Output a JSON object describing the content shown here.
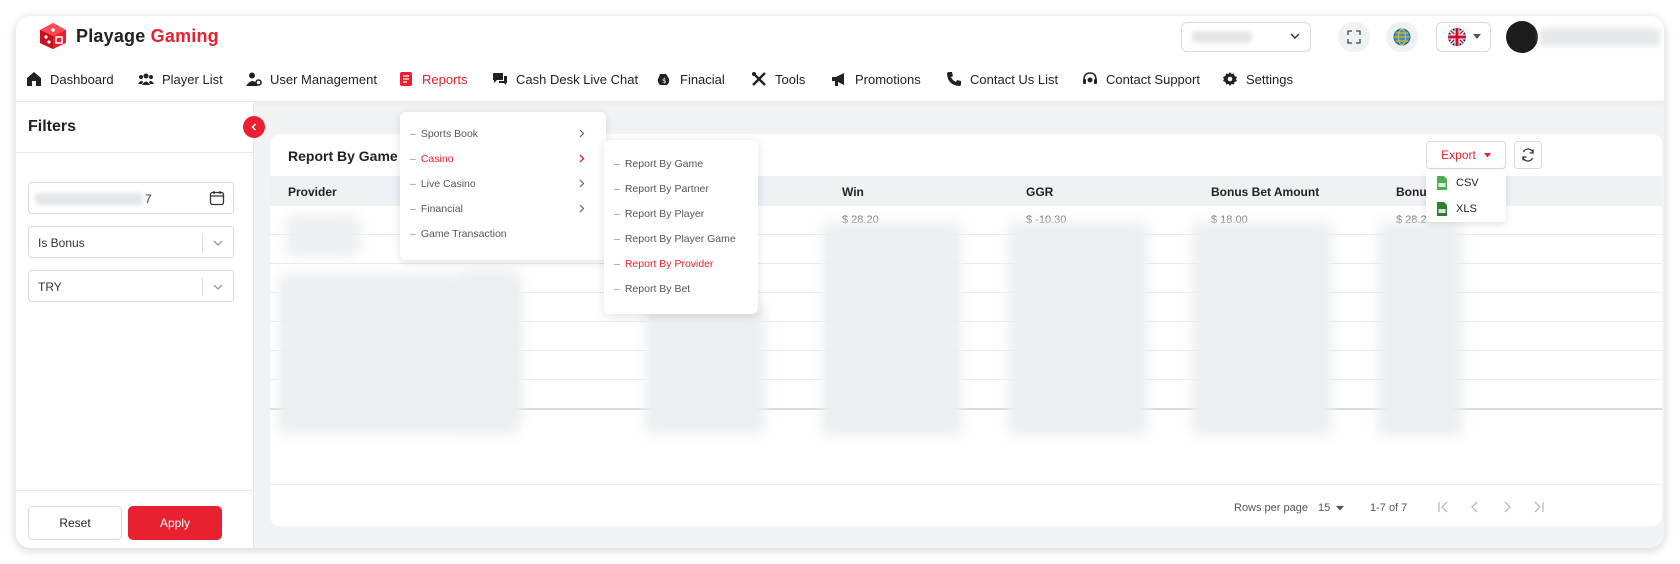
{
  "app": {
    "name_prefix": "Playage",
    "name_accent": "Gaming",
    "colors": {
      "accent": "#e8202f",
      "header_bg": "#ffffff",
      "table_head_bg": "#eef2f5"
    }
  },
  "nav": {
    "items": [
      {
        "label": "Dashboard",
        "icon": "home-icon"
      },
      {
        "label": "Player List",
        "icon": "users-icon"
      },
      {
        "label": "User Management",
        "icon": "user-gear-icon"
      },
      {
        "label": "Reports",
        "icon": "report-icon",
        "active": true
      },
      {
        "label": "Cash Desk Live Chat",
        "icon": "chat-icon"
      },
      {
        "label": "Finacial",
        "icon": "money-icon"
      },
      {
        "label": "Tools",
        "icon": "tools-icon"
      },
      {
        "label": "Promotions",
        "icon": "megaphone-icon"
      },
      {
        "label": "Contact Us List",
        "icon": "phone-icon"
      },
      {
        "label": "Contact Support",
        "icon": "headset-icon"
      },
      {
        "label": "Settings",
        "icon": "gear-icon"
      }
    ]
  },
  "filters": {
    "title": "Filters",
    "date_value": "7",
    "bonus_select": "Is Bonus",
    "currency_select": "TRY",
    "reset_label": "Reset",
    "apply_label": "Apply"
  },
  "reports_menu": {
    "items": [
      {
        "label": "Sports Book",
        "has_sub": true
      },
      {
        "label": "Casino",
        "has_sub": true,
        "active": true
      },
      {
        "label": "Live Casino",
        "has_sub": true
      },
      {
        "label": "Financial",
        "has_sub": true
      },
      {
        "label": "Game Transaction",
        "has_sub": false
      }
    ]
  },
  "casino_menu": {
    "items": [
      {
        "label": "Report By Game"
      },
      {
        "label": "Report By Partner"
      },
      {
        "label": "Report By Player"
      },
      {
        "label": "Report By Player Game"
      },
      {
        "label": "Report By Provider",
        "active": true
      },
      {
        "label": "Report By Bet"
      }
    ]
  },
  "card": {
    "title": "Report By Game P",
    "export_label": "Export",
    "export_menu": {
      "csv": "CSV",
      "xls": "XLS"
    },
    "columns": [
      "Provider",
      "Win",
      "GGR",
      "Bonus Bet Amount",
      "Bonus"
    ],
    "first_row": {
      "win": "$ 28.20",
      "ggr": "$ -10.30",
      "bonus_bet": "$ 18.00",
      "bonus": "$ 28.2"
    }
  },
  "pagination": {
    "rows_per_page_label": "Rows per page",
    "rows_per_page_value": "15",
    "range": "1-7 of 7"
  }
}
